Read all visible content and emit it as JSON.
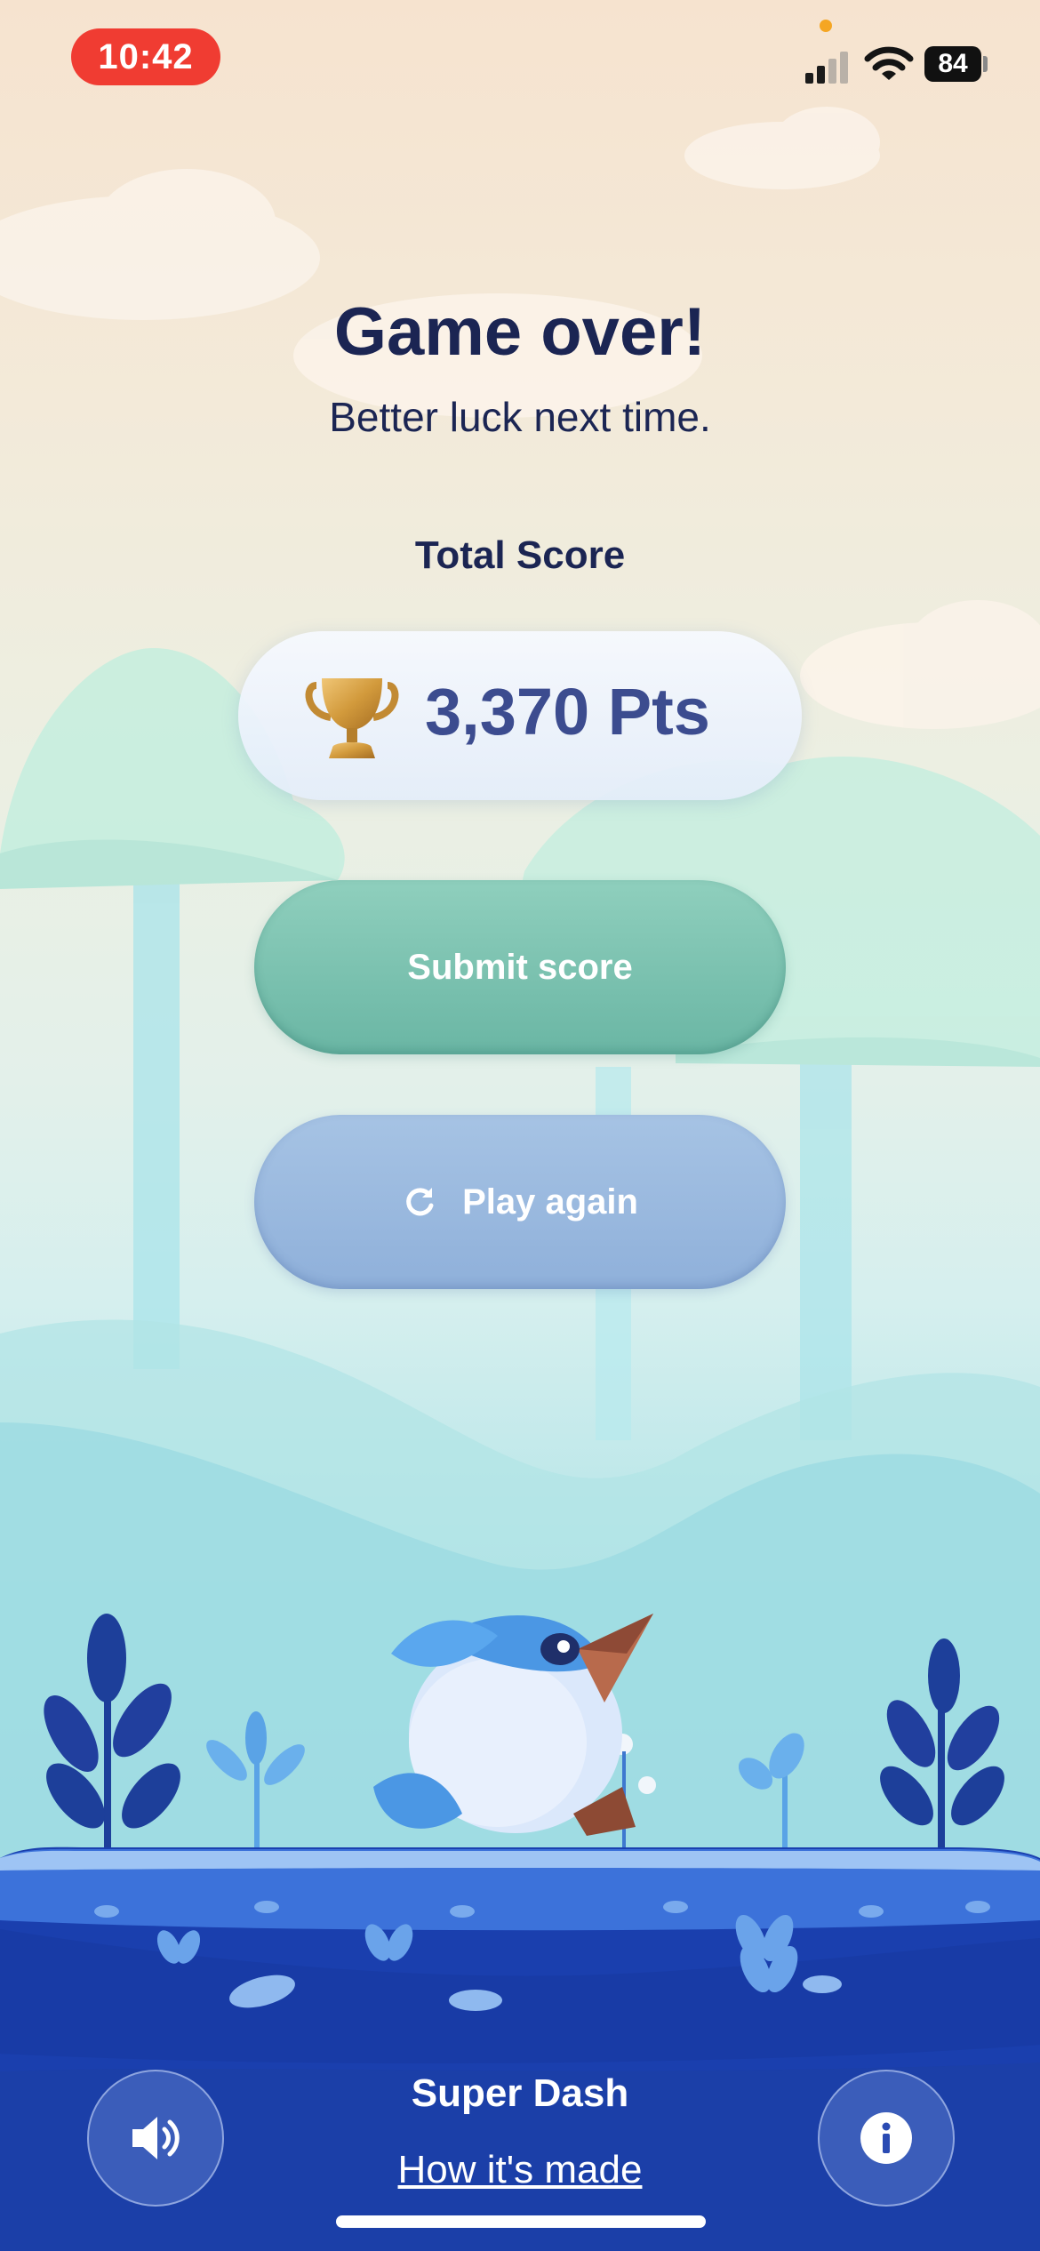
{
  "status_bar": {
    "time": "10:42",
    "battery": "84"
  },
  "game_over": {
    "title": "Game over!",
    "subtitle": "Better luck next time.",
    "score_label": "Total Score",
    "score": "3,370",
    "score_unit": "Pts"
  },
  "actions": {
    "submit_label": "Submit score",
    "play_again_label": "Play again"
  },
  "footer": {
    "game_name": "Super Dash",
    "how_made_link": "How it's made"
  },
  "icons": {
    "trophy": "trophy-icon",
    "refresh": "refresh-icon",
    "sound": "speaker-icon",
    "info": "info-icon"
  },
  "colors": {
    "title": "#1b2553",
    "score": "#3c4c8f",
    "submit": "#75bcaa",
    "play_again": "#97b6de",
    "ground": "#1a3fae"
  }
}
